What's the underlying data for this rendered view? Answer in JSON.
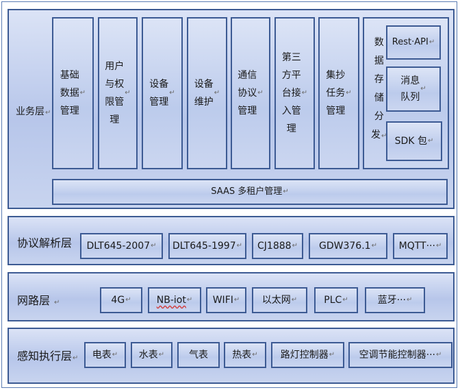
{
  "layers": {
    "business": {
      "label": "业务层",
      "boxes": [
        {
          "text": "基础\n数据\n管理"
        },
        {
          "text": "用户\n与权\n限管\n理"
        },
        {
          "text": "设备\n管理"
        },
        {
          "text": "设备\n维护"
        },
        {
          "text": "通信\n协议\n管理"
        },
        {
          "text": "第三\n方平\n台接\n入管\n理"
        },
        {
          "text": "集抄\n任务\n管理"
        }
      ],
      "data_dist": {
        "label": "数\n据\n存\n储\n分\n发",
        "items": [
          "Rest·API",
          "消息\n队列",
          "SDK 包"
        ]
      },
      "saas": "SAAS 多租户管理"
    },
    "protocol": {
      "label": "协议解析层",
      "items": [
        "DLT645-2007",
        "DLT645-1997",
        "CJ1888",
        "GDW376.1",
        "MQTT···"
      ]
    },
    "network": {
      "label": "网路层",
      "items": [
        "4G",
        "NB-iot",
        "WIFI",
        "以太网",
        "PLC",
        "蓝牙···"
      ]
    },
    "perception": {
      "label": "感知执行层",
      "items": [
        "电表",
        "水表",
        "气表",
        "热表",
        "路灯控制器",
        "空调节能控制器···"
      ]
    }
  }
}
